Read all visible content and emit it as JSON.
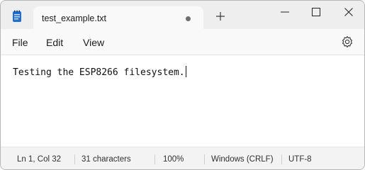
{
  "tab": {
    "title": "test_example.txt",
    "unsaved_indicator": "dot"
  },
  "icons": {
    "app": "notepad-icon",
    "new_tab": "plus-icon",
    "minimize": "minimize-icon",
    "maximize": "maximize-icon",
    "close": "close-icon",
    "settings": "gear-icon"
  },
  "menu": {
    "file": "File",
    "edit": "Edit",
    "view": "View"
  },
  "editor": {
    "content": "Testing the ESP8266 filesystem."
  },
  "status": {
    "position": "Ln 1, Col 32",
    "characters": "31 characters",
    "zoom": "100%",
    "line_endings": "Windows (CRLF)",
    "encoding": "UTF-8"
  },
  "colors": {
    "app_icon": "#1f6fd1",
    "titlebar": "#eeeeee",
    "tab": "#f9f9f9"
  }
}
